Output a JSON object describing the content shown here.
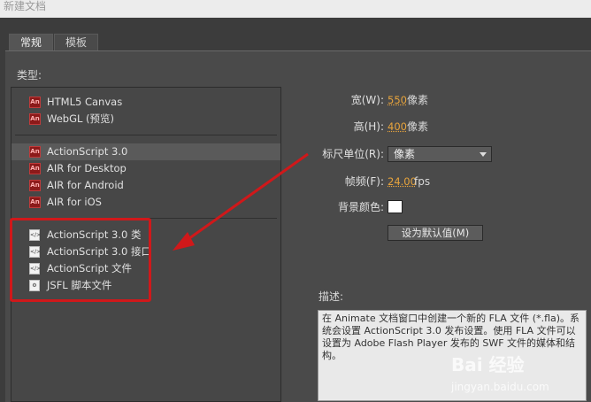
{
  "window": {
    "title": "新建文档"
  },
  "tabs": [
    {
      "label": "常规",
      "active": true
    },
    {
      "label": "模板",
      "active": false
    }
  ],
  "type_section": {
    "label": "类型:"
  },
  "doc_types": {
    "group1": [
      {
        "label": "HTML5 Canvas",
        "icon": "an-icon"
      },
      {
        "label": "WebGL (预览)",
        "icon": "an-icon"
      }
    ],
    "group2": [
      {
        "label": "ActionScript 3.0",
        "icon": "an-icon",
        "selected": true
      },
      {
        "label": "AIR for Desktop",
        "icon": "an-icon"
      },
      {
        "label": "AIR for Android",
        "icon": "an-icon"
      },
      {
        "label": "AIR for iOS",
        "icon": "an-icon"
      }
    ],
    "group3": [
      {
        "label": "ActionScript 3.0 类",
        "icon": "code-file-icon"
      },
      {
        "label": "ActionScript 3.0 接口",
        "icon": "code-file-icon"
      },
      {
        "label": "ActionScript 文件",
        "icon": "code-file-icon"
      },
      {
        "label": "JSFL 脚本文件",
        "icon": "script-file-icon"
      }
    ],
    "icon_glyph": "An"
  },
  "properties": {
    "width": {
      "label": "宽(W):",
      "value": "550",
      "unit": "像素"
    },
    "height": {
      "label": "高(H):",
      "value": "400",
      "unit": "像素"
    },
    "ruler_units": {
      "label": "标尺单位(R):",
      "value": "像素"
    },
    "frame_rate": {
      "label": "帧频(F):",
      "value": "24.00",
      "unit": "fps"
    },
    "background": {
      "label": "背景颜色:",
      "color": "#ffffff"
    },
    "set_default_button": "设为默认值(M)"
  },
  "description": {
    "label": "描述:",
    "text": "在 Animate 文档窗口中创建一个新的 FLA 文件 (*.fla)。系统会设置 ActionScript 3.0 发布设置。使用 FLA 文件可以设置为 Adobe Flash Player 发布的 SWF 文件的媒体和结构。"
  },
  "watermark": {
    "brand": "Bai 经验",
    "url": "jingyan.baidu.com"
  },
  "colors": {
    "accent_value": "#e8a43c",
    "annotation_red": "#d0181a"
  }
}
